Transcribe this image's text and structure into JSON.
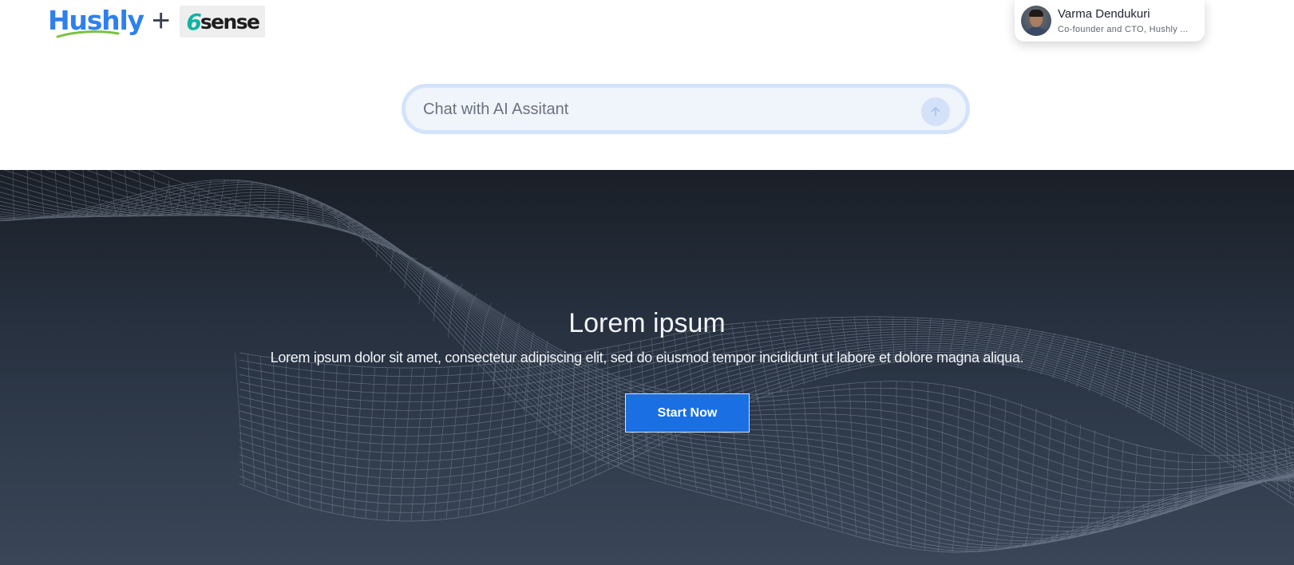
{
  "header": {
    "logo_primary": "Hushly",
    "logo_separator": "+",
    "logo_secondary_mark": "6",
    "logo_secondary_text": "sense",
    "profile": {
      "name": "Varma Dendukuri",
      "role": "Co-founder and CTO, Hushly ..."
    }
  },
  "chat": {
    "placeholder": "Chat with AI Assitant",
    "send_icon": "arrow-up-icon"
  },
  "hero": {
    "title": "Lorem ipsum",
    "subtitle": "Lorem ipsum dolor sit amet, consectetur adipiscing elit, sed do eiusmod tempor incididunt ut labore et dolore magna aliqua.",
    "cta_label": "Start Now"
  },
  "colors": {
    "brand_blue": "#2f80ed",
    "button_blue": "#1a6fe3",
    "sixsense_teal": "#0fb4a0",
    "hero_dark": "#1a1f27",
    "hero_light": "#3a4658"
  }
}
